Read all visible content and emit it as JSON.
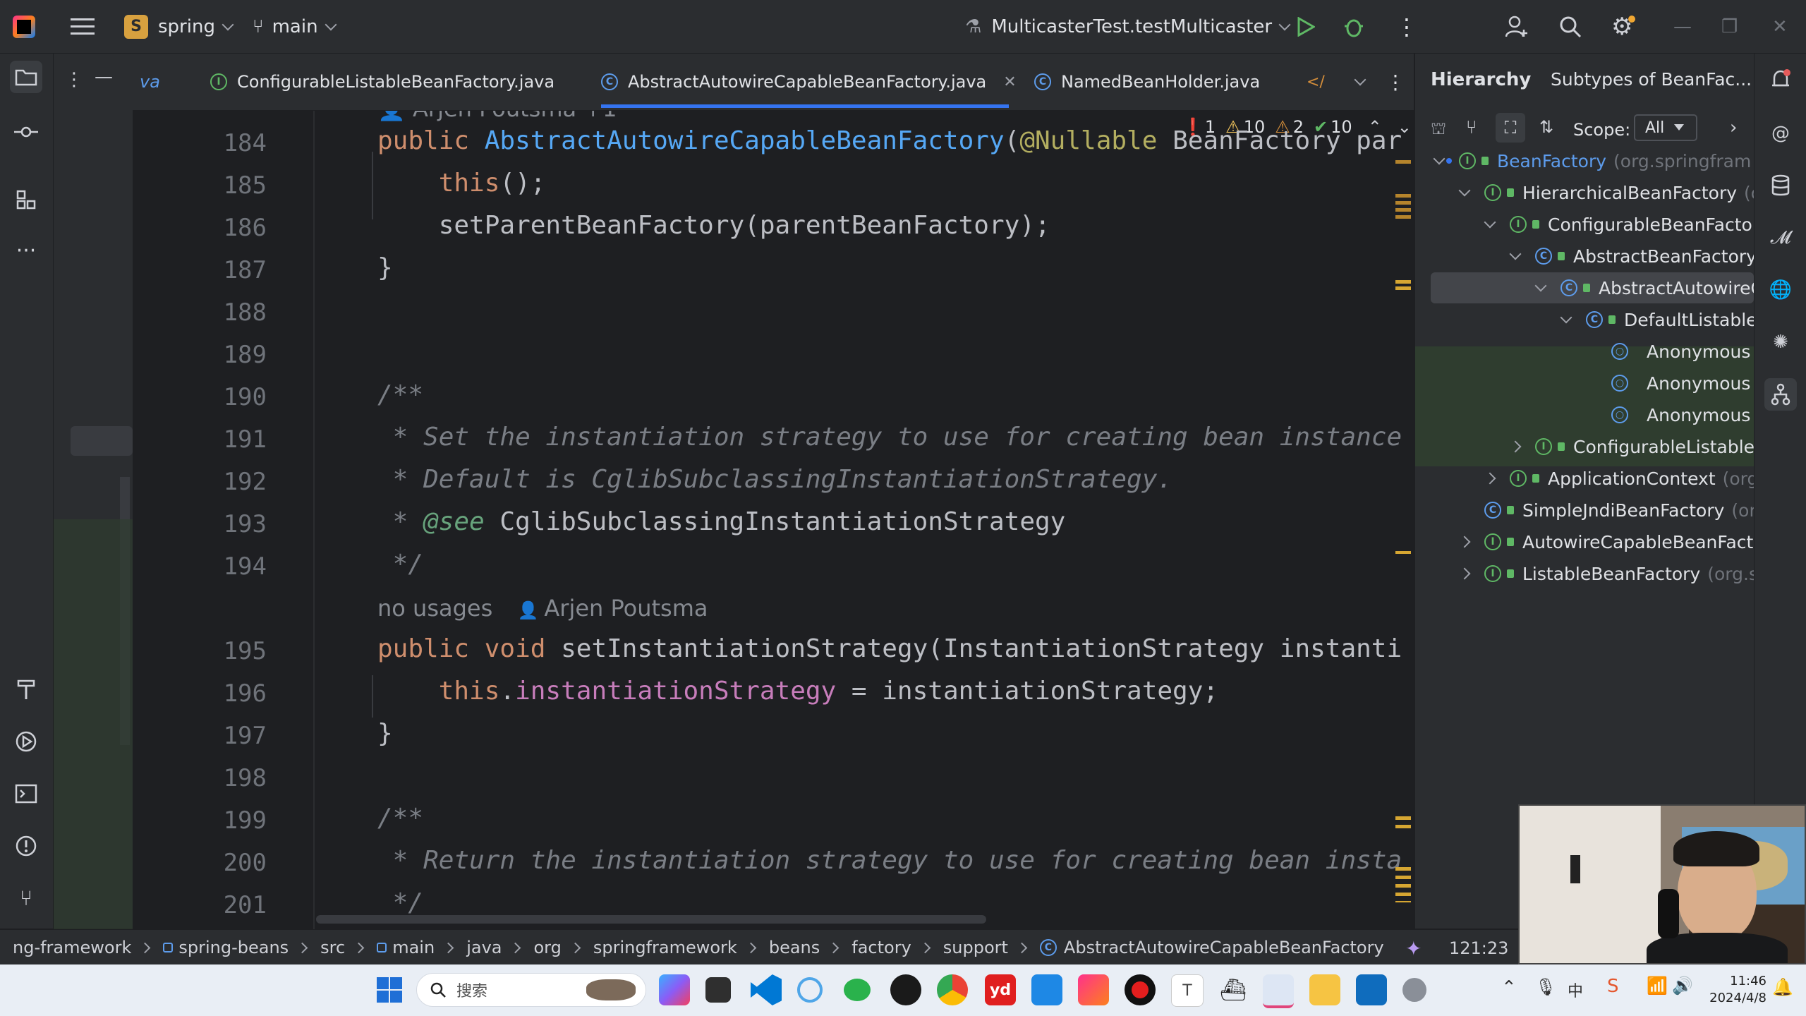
{
  "titlebar": {
    "project_badge": "S",
    "project_name": "spring",
    "branch": "main",
    "run_config": "MulticasterTest.testMulticaster"
  },
  "tabs": [
    {
      "label": "va",
      "type": "partial"
    },
    {
      "label": "ConfigurableListableBeanFactory.java",
      "type": "interface"
    },
    {
      "label": "AbstractAutowireCapableBeanFactory.java",
      "type": "class",
      "active": true
    },
    {
      "label": "NamedBeanHolder.java",
      "type": "class"
    }
  ],
  "inspections": {
    "errors": "1",
    "warnings": "10",
    "weak_warnings": "2",
    "ok": "10"
  },
  "editor": {
    "author_hint_top": "Arjen Poutsma",
    "lines": [
      {
        "n": "184",
        "tokens": [
          {
            "t": "public ",
            "c": "kw"
          },
          {
            "t": "AbstractAutowireCapableBeanFactory",
            "c": "fn"
          },
          {
            "t": "(",
            "c": "plain"
          },
          {
            "t": "@Nullable",
            "c": "ann"
          },
          {
            "t": " BeanFactory par",
            "c": "plain"
          }
        ]
      },
      {
        "n": "185",
        "tokens": [
          {
            "t": "    this",
            "c": "kw"
          },
          {
            "t": "();",
            "c": "plain"
          }
        ]
      },
      {
        "n": "186",
        "tokens": [
          {
            "t": "    setParentBeanFactory(parentBeanFactory);",
            "c": "plain"
          }
        ]
      },
      {
        "n": "187",
        "tokens": [
          {
            "t": "}",
            "c": "plain"
          }
        ]
      },
      {
        "n": "188",
        "tokens": []
      },
      {
        "n": "189",
        "tokens": []
      },
      {
        "n": "190",
        "tokens": [
          {
            "t": "/**",
            "c": "cm"
          }
        ]
      },
      {
        "n": "191",
        "tokens": [
          {
            "t": " * Set the instantiation strategy to use for creating bean instance",
            "c": "cm"
          }
        ]
      },
      {
        "n": "192",
        "tokens": [
          {
            "t": " * Default is CglibSubclassingInstantiationStrategy.",
            "c": "cm"
          }
        ]
      },
      {
        "n": "193",
        "tokens": [
          {
            "t": " * ",
            "c": "cm"
          },
          {
            "t": "@see",
            "c": "cmtag"
          },
          {
            "t": " CglibSubclassingInstantiationStrategy",
            "c": "plain"
          }
        ]
      },
      {
        "n": "194",
        "tokens": [
          {
            "t": " */",
            "c": "cm"
          }
        ]
      },
      {
        "n": "",
        "hint": true,
        "usages": "no usages",
        "author": "Arjen Poutsma"
      },
      {
        "n": "195",
        "tokens": [
          {
            "t": "public void ",
            "c": "kw"
          },
          {
            "t": "setInstantiationStrategy",
            "c": "plain"
          },
          {
            "t": "(InstantiationStrategy instanti",
            "c": "plain"
          }
        ]
      },
      {
        "n": "196",
        "tokens": [
          {
            "t": "    this",
            "c": "kw"
          },
          {
            "t": ".",
            "c": "plain"
          },
          {
            "t": "instantiationStrategy",
            "c": "fld"
          },
          {
            "t": " = instantiationStrategy;",
            "c": "plain"
          }
        ]
      },
      {
        "n": "197",
        "tokens": [
          {
            "t": "}",
            "c": "plain"
          }
        ]
      },
      {
        "n": "198",
        "tokens": []
      },
      {
        "n": "199",
        "tokens": [
          {
            "t": "/**",
            "c": "cm"
          }
        ]
      },
      {
        "n": "200",
        "tokens": [
          {
            "t": " * Return the instantiation strategy to use for creating bean insta",
            "c": "cm"
          }
        ]
      },
      {
        "n": "201",
        "tokens": [
          {
            "t": " */",
            "c": "cm"
          }
        ]
      }
    ]
  },
  "hierarchy": {
    "tab_hierarchy": "Hierarchy",
    "tab_subtypes": "Subtypes of BeanFac...",
    "scope_label": "Scope:",
    "scope_value": "All",
    "nodes": [
      {
        "label": "BeanFactory",
        "pkg": "(org.springfram",
        "kind": "interface",
        "depth": 0,
        "exp": "down",
        "mark": true
      },
      {
        "label": "HierarchicalBeanFactory",
        "pkg": "(or",
        "kind": "interface",
        "depth": 1,
        "exp": "down"
      },
      {
        "label": "ConfigurableBeanFactory",
        "pkg": "",
        "kind": "interface",
        "depth": 2,
        "exp": "down"
      },
      {
        "label": "AbstractBeanFactory",
        "pkg": "",
        "kind": "class",
        "depth": 3,
        "exp": "down"
      },
      {
        "label": "AbstractAutowireC",
        "pkg": "",
        "kind": "class",
        "depth": 4,
        "exp": "down",
        "selected": true
      },
      {
        "label": "DefaultListable",
        "pkg": "",
        "kind": "class",
        "depth": 5,
        "exp": "down"
      },
      {
        "label": "Anonymous",
        "pkg": "",
        "kind": "anon",
        "depth": 6,
        "exp": "none",
        "green": true
      },
      {
        "label": "Anonymous",
        "pkg": "",
        "kind": "anon",
        "depth": 6,
        "exp": "none",
        "green": true
      },
      {
        "label": "Anonymous",
        "pkg": "",
        "kind": "anon",
        "depth": 6,
        "exp": "none",
        "green": true
      },
      {
        "label": "ConfigurableListableE",
        "pkg": "",
        "kind": "interface",
        "depth": 3,
        "exp": "right"
      },
      {
        "label": "ApplicationContext",
        "pkg": "(org.s",
        "kind": "interface",
        "depth": 2,
        "exp": "right"
      },
      {
        "label": "SimpleJndiBeanFactory",
        "pkg": "(org",
        "kind": "class",
        "depth": 1,
        "exp": "none"
      },
      {
        "label": "AutowireCapableBeanFacto",
        "pkg": "",
        "kind": "interface",
        "depth": 1,
        "exp": "right"
      },
      {
        "label": "ListableBeanFactory",
        "pkg": "(org.sp",
        "kind": "interface",
        "depth": 1,
        "exp": "right"
      }
    ]
  },
  "statusbar": {
    "crumbs": [
      "ng-framework",
      "spring-beans",
      "src",
      "main",
      "java",
      "org",
      "springframework",
      "beans",
      "factory",
      "support",
      "AbstractAutowireCapableBeanFactory"
    ],
    "position": "121:23"
  },
  "taskbar": {
    "search_placeholder": "搜索",
    "time": "11:46",
    "date": "2024/4/8"
  },
  "colors": {
    "accent": "#3574f0",
    "class_icon": "#5d9cec",
    "interface_icon": "#5fb865",
    "run_green": "#5fb865"
  }
}
